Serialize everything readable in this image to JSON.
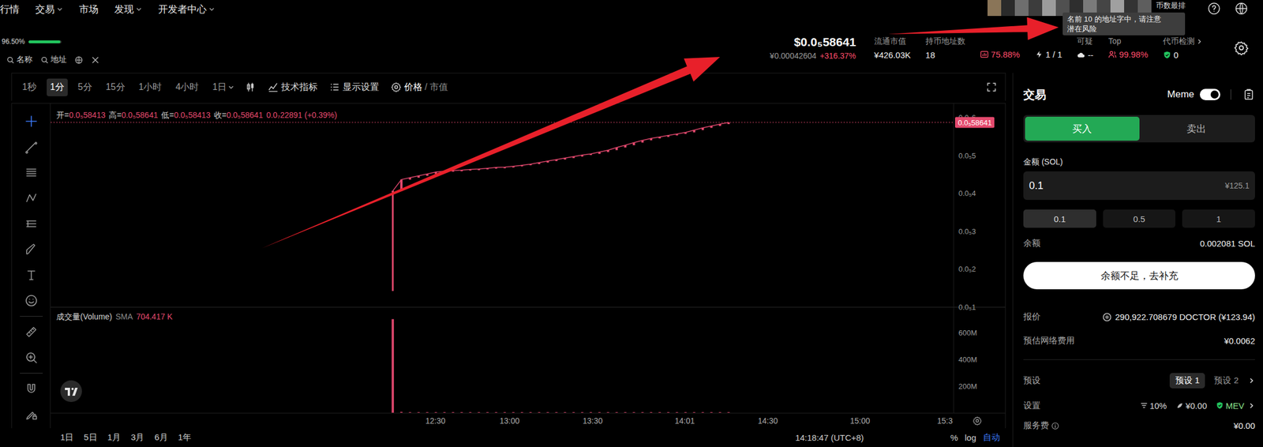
{
  "nav": {
    "items": [
      {
        "label": "行情",
        "dropdown": false
      },
      {
        "label": "交易",
        "dropdown": true
      },
      {
        "label": "市场",
        "dropdown": false
      },
      {
        "label": "发现",
        "dropdown": true
      },
      {
        "label": "开发者中心",
        "dropdown": true
      }
    ],
    "notice": "币数最排",
    "tooltip": [
      "名前 10 的地址字中，请注意",
      "潜在风险"
    ]
  },
  "score": {
    "reading": "96.50%",
    "level": 0.965
  },
  "search": [
    {
      "label": "名称"
    },
    {
      "label": "地址"
    }
  ],
  "ticker": {
    "price": "$0.0₅58641",
    "cny": "¥0.00042604",
    "change": "+316.37%"
  },
  "stats": [
    {
      "label": "流通市值",
      "value": "¥426.03K",
      "color": "#f2f2f2",
      "kind": "none",
      "link": false
    },
    {
      "label": "持币地址数",
      "value": "18",
      "color": "#f2f2f2",
      "kind": "none",
      "link": false
    },
    {
      "value": "75.88%",
      "color": "#ff4d6a",
      "kind": "chart",
      "link": false
    },
    {
      "value": "1 / 1",
      "color": "#f2f2f2",
      "kind": "bolt",
      "link": false
    },
    {
      "label": "可疑",
      "value": "--",
      "color": "#f2f2f2",
      "kind": "cloud",
      "link": false
    },
    {
      "label": "Top",
      "value": "99.98%",
      "color": "#ff4d6a",
      "kind": "people",
      "link": false
    },
    {
      "label": "代币检测",
      "value": "0",
      "color": "#f2f2f2",
      "kind": "shield",
      "link": true
    }
  ],
  "toolbar": {
    "intervals": [
      {
        "label": "1秒",
        "selected": false,
        "dropdown": false
      },
      {
        "label": "1分",
        "selected": true,
        "dropdown": false
      },
      {
        "label": "5分",
        "selected": false,
        "dropdown": false
      },
      {
        "label": "15分",
        "selected": false,
        "dropdown": false
      },
      {
        "label": "1小时",
        "selected": false,
        "dropdown": false
      },
      {
        "label": "4小时",
        "selected": false,
        "dropdown": false
      },
      {
        "label": "1日",
        "selected": false,
        "dropdown": true
      }
    ],
    "indicators": "技术指标",
    "display": "显示设置",
    "modes": [
      {
        "label": "价格",
        "selected": true
      },
      {
        "label": "市值",
        "selected": false
      }
    ],
    "mode_separator": "/"
  },
  "chart": {
    "ohlc": {
      "items": [
        {
          "label": "开=",
          "value": "0.0₅58413"
        },
        {
          "label": "高=",
          "value": "0.0₅58641"
        },
        {
          "label": "低=",
          "value": "0.0₅58413"
        },
        {
          "label": "收=",
          "value": "0.0₅58641"
        }
      ],
      "change": "0.0₇22891 (+0.39%)"
    },
    "y_ticks": [
      "0.0₅6",
      "0.0₅5",
      "0.0₅4",
      "0.0₅3",
      "0.0₅2",
      "0.0₅1"
    ],
    "price_tag": "0.0₅58641",
    "x_ticks": [
      "12:30",
      "13:00",
      "13:30",
      "14:01",
      "14:30",
      "15:00",
      "15:3"
    ],
    "price": {
      "first_low": 1.4,
      "values": [
        4.05,
        4.35,
        4.4,
        4.45,
        4.5,
        4.55,
        4.57,
        4.59,
        4.6,
        4.62,
        4.63,
        4.65,
        4.67,
        4.68,
        4.7,
        4.73,
        4.76,
        4.8,
        4.84,
        4.88,
        4.92,
        4.96,
        5.0,
        5.03,
        5.08,
        5.13,
        5.2,
        5.26,
        5.33,
        5.39,
        5.44,
        5.48,
        5.52,
        5.56,
        5.6,
        5.66,
        5.72,
        5.77,
        5.82,
        5.8641
      ]
    },
    "volume": {
      "title": "成交量(Volume)",
      "sma": "SMA",
      "reading": "704.417 K",
      "ticks": [
        "600M",
        "400M",
        "200M"
      ],
      "values": [
        700,
        6,
        4,
        3,
        3,
        2,
        3,
        2,
        2,
        3,
        2,
        2,
        2,
        3,
        2,
        2,
        3,
        2,
        2,
        3,
        2,
        3,
        2,
        2,
        3,
        3,
        2,
        3,
        2,
        3,
        2,
        2,
        3,
        2,
        3,
        2,
        3,
        2,
        3,
        2
      ]
    }
  },
  "footer": {
    "ranges": [
      "1日",
      "5日",
      "1月",
      "3月",
      "6月",
      "1年"
    ],
    "time": "14:18:47 (UTC+8)",
    "options": [
      {
        "label": "%",
        "selected": false
      },
      {
        "label": "log",
        "selected": false
      },
      {
        "label": "自动",
        "selected": true
      }
    ]
  },
  "trade": {
    "title": "交易",
    "meme": {
      "label": "Meme",
      "on": true
    },
    "sides": [
      {
        "label": "买入",
        "selected": true
      },
      {
        "label": "卖出",
        "selected": false
      }
    ],
    "amount": {
      "label": "金额 (SOL)",
      "value": "0.1",
      "cny": "¥125.1"
    },
    "presets": [
      {
        "label": "0.1",
        "selected": true
      },
      {
        "label": "0.5",
        "selected": false
      },
      {
        "label": "1",
        "selected": false
      }
    ],
    "balance": {
      "label": "余额",
      "value": "0.002081 SOL"
    },
    "action": "余额不足，去补充",
    "quote": {
      "label": "报价",
      "value": "290,922.708679 DOCTOR (¥123.94)"
    },
    "network_fee": {
      "label": "预估网络费用",
      "value": "¥0.0062"
    },
    "preset_tabs": {
      "label": "预设",
      "items": [
        {
          "label": "预设 1",
          "selected": true
        },
        {
          "label": "预设 2",
          "selected": false
        }
      ]
    },
    "settings": {
      "label": "设置",
      "items": [
        {
          "kind": "slippage",
          "value": "10%"
        },
        {
          "kind": "fee",
          "value": "¥0.00"
        },
        {
          "kind": "mev",
          "value": "MEV"
        }
      ]
    },
    "service_fee": {
      "label": "服务费",
      "value": "¥0.00"
    }
  }
}
